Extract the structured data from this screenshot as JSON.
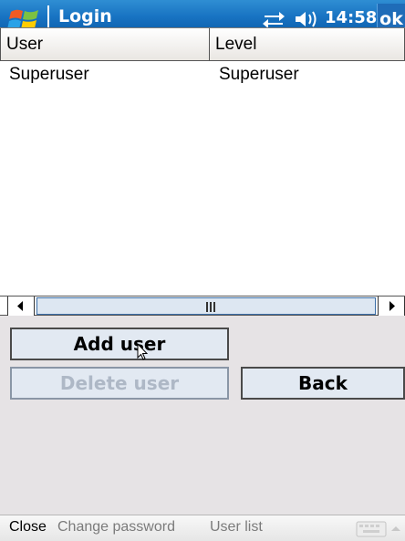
{
  "titlebar": {
    "title": "Login",
    "time": "14:58",
    "ok_label": "ok",
    "start_icon": "windows-flag-icon",
    "connectivity_icon": "connectivity-arrows-icon",
    "volume_icon": "speaker-volume-icon"
  },
  "list": {
    "columns": [
      "User",
      "Level"
    ],
    "rows": [
      {
        "user": "Superuser",
        "level": "Superuser"
      }
    ],
    "scroll_thumb_grip": "III"
  },
  "buttons": {
    "add_user": "Add user",
    "delete_user": "Delete user",
    "back": "Back",
    "delete_user_disabled": true
  },
  "menubar": {
    "close": "Close",
    "change_password": "Change password",
    "user_list": "User list",
    "keyboard_icon": "keyboard-icon"
  },
  "colors": {
    "titlebar": "#1873c2",
    "button_area": "#e6e3e5",
    "button_fill": "#e2e9f2",
    "disabled_text": "#aeb8c6",
    "menu_disabled_text": "#7b7b7b"
  }
}
